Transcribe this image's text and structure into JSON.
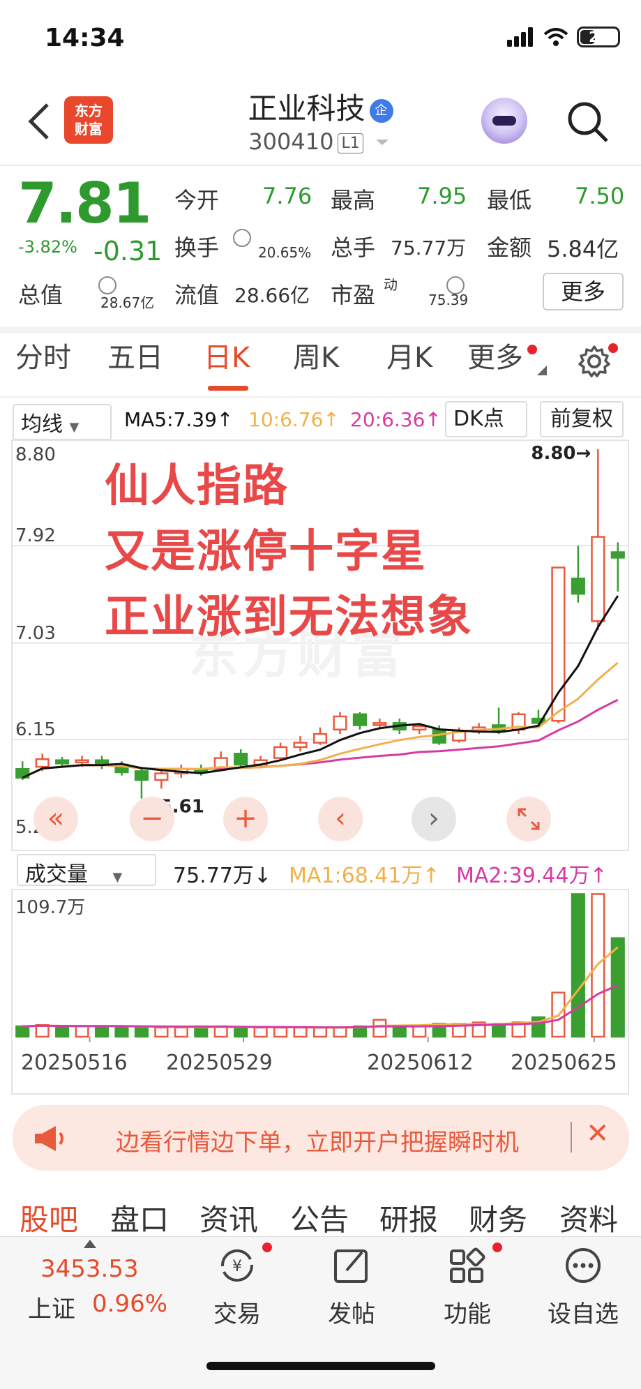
{
  "status_bar": {
    "time": "14:34",
    "battery": "27"
  },
  "header": {
    "logo_line1": "东方",
    "logo_line2": "财富",
    "stock_name": "正业科技",
    "badge": "企",
    "stock_code": "300410",
    "level": "L1"
  },
  "quote": {
    "price": "7.81",
    "change_pct": "-3.82%",
    "change": "-0.31",
    "open_label": "今开",
    "open": "7.76",
    "high_label": "最高",
    "high": "7.95",
    "low_label": "最低",
    "low": "7.50",
    "turnover_label": "换手",
    "turnover": "20.65%",
    "volume_label": "总手",
    "volume": "75.77万",
    "amount_label": "金额",
    "amount": "5.84亿",
    "mktcap_label": "总值",
    "mktcap": "28.67亿",
    "float_label": "流值",
    "float_cap": "28.66亿",
    "pe_label": "市盈",
    "pe_sup": "动",
    "pe": "75.39",
    "more_button": "更多"
  },
  "tabs": [
    "分时",
    "五日",
    "日K",
    "周K",
    "月K",
    "更多"
  ],
  "ma_bar": {
    "indicator": "均线",
    "ma5": "MA5:7.39↑",
    "ma10": "10:6.76↑",
    "ma20": "20:6.36↑",
    "dk": "DK点",
    "adjust": "前复权"
  },
  "chart_overlay": [
    "仙人指路",
    "又是涨停十字星",
    "正业涨到无法想象"
  ],
  "watermark": "东方财富",
  "chart_data": {
    "type": "candlestick",
    "y_ticks": [
      "8.80",
      "7.92",
      "7.03",
      "6.15",
      "5.27"
    ],
    "ylim": [
      5.27,
      8.8
    ],
    "annotations": {
      "high": "8.80→",
      "low": "←5.61"
    },
    "candles": [
      {
        "o": 5.88,
        "c": 5.8,
        "h": 5.95,
        "l": 5.78
      },
      {
        "o": 5.9,
        "c": 5.97,
        "h": 6.02,
        "l": 5.86
      },
      {
        "o": 5.96,
        "c": 5.93,
        "h": 5.99,
        "l": 5.9
      },
      {
        "o": 5.94,
        "c": 5.96,
        "h": 6.0,
        "l": 5.9
      },
      {
        "o": 5.96,
        "c": 5.92,
        "h": 6.0,
        "l": 5.88
      },
      {
        "o": 5.92,
        "c": 5.85,
        "h": 5.95,
        "l": 5.82
      },
      {
        "o": 5.86,
        "c": 5.78,
        "h": 5.9,
        "l": 5.61
      },
      {
        "o": 5.78,
        "c": 5.84,
        "h": 5.88,
        "l": 5.7
      },
      {
        "o": 5.84,
        "c": 5.88,
        "h": 5.92,
        "l": 5.8
      },
      {
        "o": 5.88,
        "c": 5.86,
        "h": 5.92,
        "l": 5.82
      },
      {
        "o": 5.88,
        "c": 5.98,
        "h": 6.04,
        "l": 5.86
      },
      {
        "o": 6.02,
        "c": 5.92,
        "h": 6.06,
        "l": 5.9
      },
      {
        "o": 5.92,
        "c": 5.96,
        "h": 6.0,
        "l": 5.9
      },
      {
        "o": 5.98,
        "c": 6.08,
        "h": 6.12,
        "l": 5.96
      },
      {
        "o": 6.08,
        "c": 6.12,
        "h": 6.18,
        "l": 6.04
      },
      {
        "o": 6.12,
        "c": 6.2,
        "h": 6.26,
        "l": 6.1
      },
      {
        "o": 6.24,
        "c": 6.36,
        "h": 6.4,
        "l": 6.2
      },
      {
        "o": 6.38,
        "c": 6.28,
        "h": 6.4,
        "l": 6.24
      },
      {
        "o": 6.3,
        "c": 6.3,
        "h": 6.34,
        "l": 6.26
      },
      {
        "o": 6.3,
        "c": 6.24,
        "h": 6.34,
        "l": 6.2
      },
      {
        "o": 6.24,
        "c": 6.27,
        "h": 6.3,
        "l": 6.2
      },
      {
        "o": 6.24,
        "c": 6.12,
        "h": 6.28,
        "l": 6.1
      },
      {
        "o": 6.14,
        "c": 6.22,
        "h": 6.26,
        "l": 6.12
      },
      {
        "o": 6.22,
        "c": 6.26,
        "h": 6.3,
        "l": 6.2
      },
      {
        "o": 6.28,
        "c": 6.22,
        "h": 6.44,
        "l": 6.2
      },
      {
        "o": 6.24,
        "c": 6.38,
        "h": 6.4,
        "l": 6.2
      },
      {
        "o": 6.34,
        "c": 6.3,
        "h": 6.42,
        "l": 6.28
      },
      {
        "o": 6.32,
        "c": 7.72,
        "h": 7.72,
        "l": 6.3
      },
      {
        "o": 7.62,
        "c": 7.48,
        "h": 7.92,
        "l": 7.4
      },
      {
        "o": 7.23,
        "c": 8.0,
        "h": 8.8,
        "l": 7.15
      },
      {
        "o": 7.86,
        "c": 7.81,
        "h": 7.95,
        "l": 7.5
      }
    ],
    "x_ticks": [
      "20250516",
      "20250529",
      "20250612",
      "20250625"
    ]
  },
  "volume_bar": {
    "indicator": "成交量",
    "volume": "75.77万↓",
    "ma1": "MA1:68.41万↑",
    "ma2": "MA2:39.44万↑",
    "max_label": "109.7万"
  },
  "volume_data": {
    "max": 109.7,
    "values": [
      8,
      9,
      8,
      8,
      8,
      8,
      7,
      7,
      7,
      8,
      8,
      7,
      7,
      7,
      7,
      7,
      7,
      8,
      13,
      8,
      8,
      10,
      10,
      11,
      10,
      11,
      15,
      34,
      110,
      110,
      76
    ]
  },
  "banner": {
    "text": "边看行情边下单，立即开户把握瞬时机"
  },
  "bottom_tabs": [
    "股吧",
    "盘口",
    "资讯",
    "公告",
    "研报",
    "财务",
    "资料"
  ],
  "footer": {
    "index_value": "3453.53",
    "index_name": "上证",
    "index_pct": "0.96%",
    "trade": "交易",
    "post": "发帖",
    "func": "功能",
    "watch": "设自选",
    "yen_icon": "¥"
  },
  "colors": {
    "up": "#e9593c",
    "down": "#3a9e31",
    "ma5": "#111111",
    "ma10": "#f2b04a",
    "ma20": "#d63aa3"
  }
}
